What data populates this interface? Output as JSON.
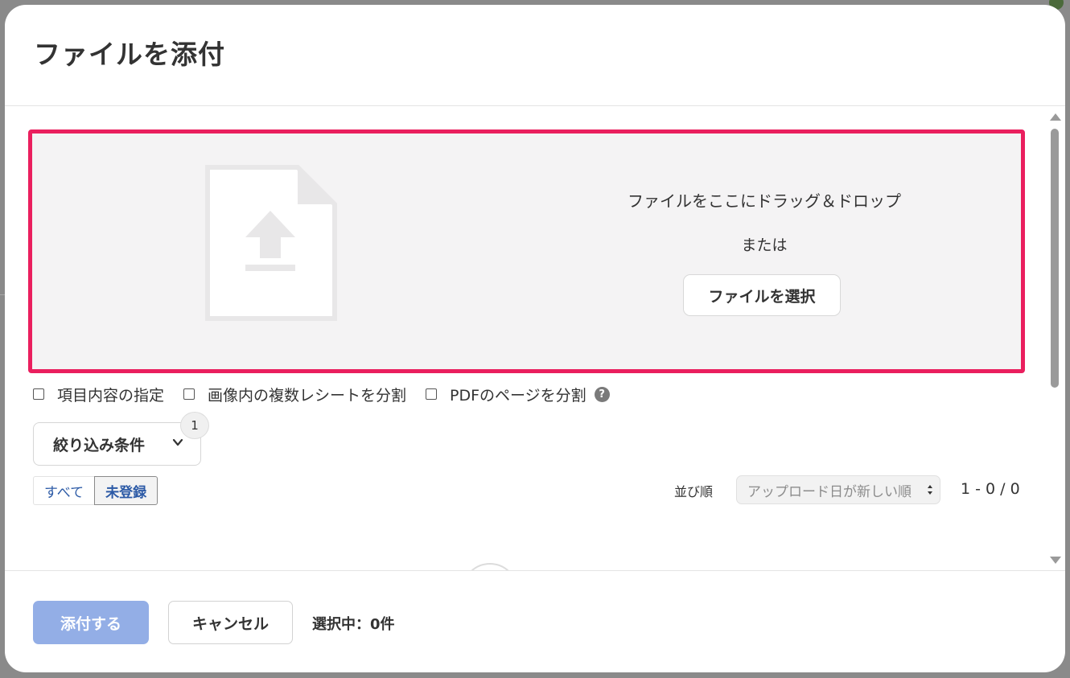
{
  "modal": {
    "title": "ファイルを添付"
  },
  "dropzone": {
    "drag_text": "ファイルをここにドラッグ＆ドロップ",
    "or_text": "または",
    "select_button_label": "ファイルを選択",
    "icon": "file-upload-icon",
    "border_color": "#ea1f5e"
  },
  "options": [
    {
      "label": "項目内容の指定",
      "checked": false
    },
    {
      "label": "画像内の複数レシートを分割",
      "checked": false
    },
    {
      "label": "PDFのページを分割",
      "checked": false
    }
  ],
  "options_help_icon": "?",
  "filter": {
    "label": "絞り込み条件",
    "badge_count": "1",
    "icon": "chevron-down-icon"
  },
  "tabs": [
    {
      "label": "すべて",
      "active": false
    },
    {
      "label": "未登録",
      "active": true
    }
  ],
  "sort": {
    "label": "並び順",
    "selected": "アップロード日が新しい順"
  },
  "pagination": {
    "count_text": "1 - 0 / 0"
  },
  "footer": {
    "attach_label": "添付する",
    "attach_disabled": true,
    "cancel_label": "キャンセル",
    "selection_status": "選択中：0件"
  },
  "colors": {
    "accent": "#2c5aa6",
    "primary_disabled": "#93aee6",
    "highlight": "#ea1f5e"
  }
}
